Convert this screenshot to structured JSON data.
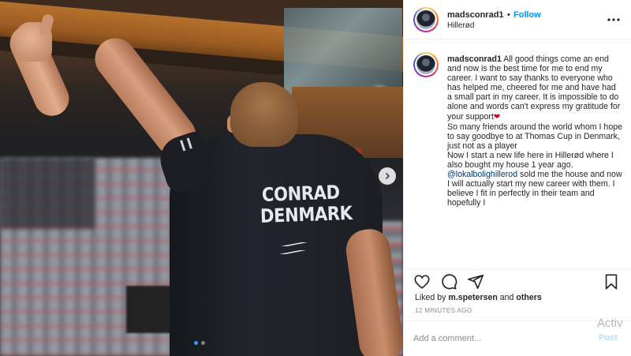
{
  "post": {
    "username": "madsconrad1",
    "follow_label": "Follow",
    "separator": "•",
    "location": "Hillerød",
    "more_icon": "more-horizontal-icon"
  },
  "photo": {
    "jersey_line1": "CONRAD",
    "jersey_line2": "DENMARK",
    "carousel_index": 1,
    "carousel_total": 2,
    "next_icon": "chevron-right-icon"
  },
  "caption": {
    "username": "madsconrad1",
    "para1": "All good things come an end and now is the best time for me to end my career. I want to say thanks to everyone who has helped me, cheered for me and have had a small part in my career. It is impossible to do alone and words can't express my gratitude for your support",
    "heart": "❤",
    "para2": "So many friends around the world whom I hope to say goodbye to at Thomas Cup in Denmark, just not as a player",
    "para3": "Now I start a new life here in Hillerød where I also bought my house 1 year ago.",
    "mention": "@lokalbolighillerod",
    "para4": " sold me the house and now I will actually start my new career with them. I believe I fit in perfectly in their team and hopefully I"
  },
  "actions": {
    "like_icon": "heart-icon",
    "comment_icon": "comment-icon",
    "share_icon": "share-icon",
    "save_icon": "bookmark-icon"
  },
  "likes": {
    "prefix": "Liked by ",
    "user": "m.spetersen",
    "middle": " and ",
    "others": "others"
  },
  "timestamp": "12 minutes ago",
  "comment": {
    "placeholder": "Add a comment...",
    "post_label": "Post"
  },
  "watermark": {
    "line1": "Activ"
  },
  "colors": {
    "link_blue": "#0095f6",
    "text": "#262626",
    "muted": "#8e8e8e",
    "heart_red": "#d6001c"
  }
}
